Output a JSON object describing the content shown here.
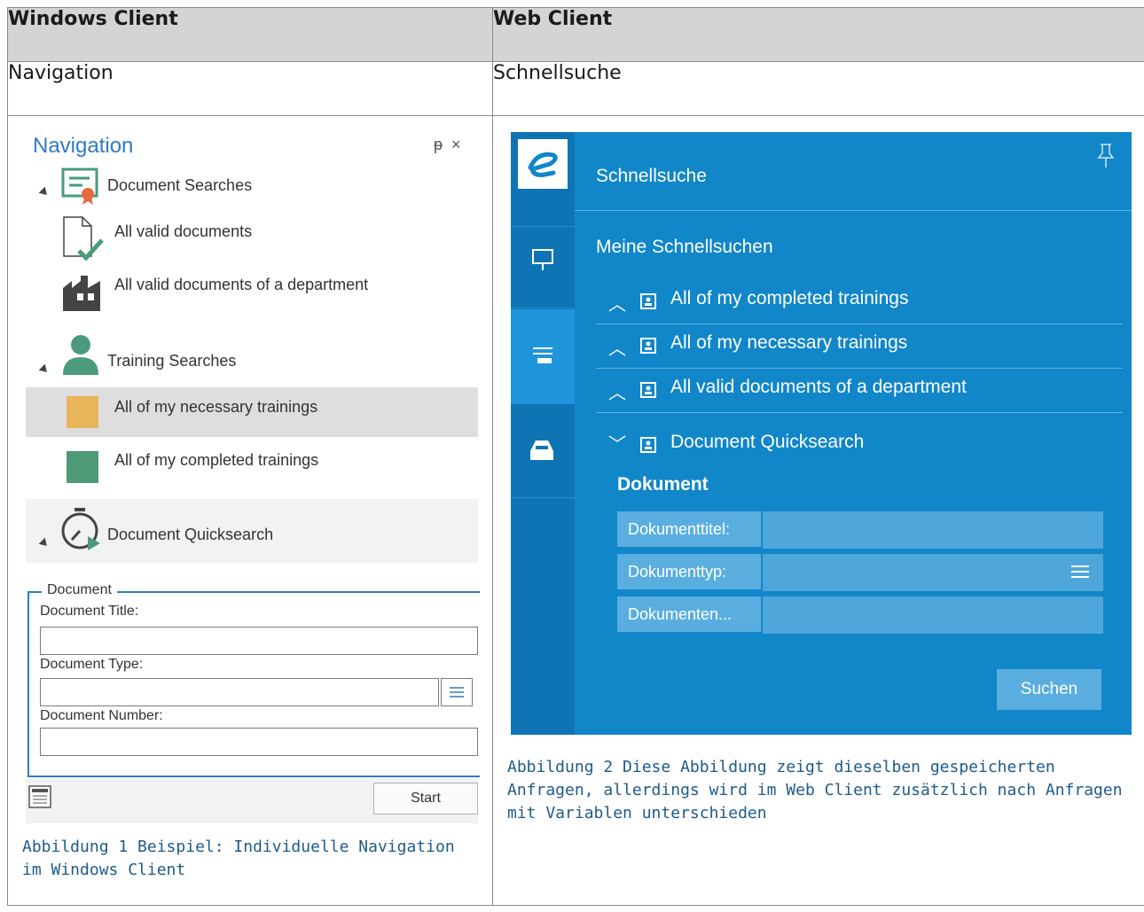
{
  "table": {
    "header_left": "Windows Client",
    "header_right": "Web Client",
    "sub_left": "Navigation",
    "sub_right": "Schnellsuche"
  },
  "windows_client": {
    "panel_title": "Navigation",
    "pin_glyph": "ᵽ",
    "close_glyph": "×",
    "groups": [
      {
        "label": "Document Searches",
        "icon": "certificate-icon",
        "items": [
          {
            "label": "All valid documents",
            "icon": "document-check-icon"
          },
          {
            "label": "All valid documents of a department",
            "icon": "factory-icon"
          }
        ]
      },
      {
        "label": "Training Searches",
        "icon": "person-icon",
        "items": [
          {
            "label": "All of my necessary trainings",
            "color": "#e8b55a",
            "selected": true
          },
          {
            "label": "All of my completed trainings",
            "color": "#4f9a77"
          }
        ]
      },
      {
        "label": "Document Quicksearch",
        "icon": "stopwatch-play-icon"
      }
    ],
    "form": {
      "legend": "Document",
      "title_label": "Document Title:",
      "type_label": "Document Type:",
      "number_label": "Document Number:",
      "title_value": "",
      "type_value": "",
      "number_value": ""
    },
    "start_label": "Start"
  },
  "web_client": {
    "header": "Schnellsuche",
    "section": "Meine Schnellsuchen",
    "items": [
      {
        "label": "All of my completed trainings",
        "expanded": false
      },
      {
        "label": "All of my necessary trainings",
        "expanded": false
      },
      {
        "label": "All valid documents of a department",
        "expanded": false
      },
      {
        "label": "Document Quicksearch",
        "expanded": true
      }
    ],
    "group_title": "Dokument",
    "fields": [
      {
        "label": "Dokumenttitel:",
        "value": ""
      },
      {
        "label": "Dokumenttyp:",
        "value": ""
      },
      {
        "label": "Dokumenten...",
        "value": ""
      }
    ],
    "search_label": "Suchen",
    "colors": {
      "panel": "#1186c9",
      "sidebar": "#0f74b4",
      "field": "#5aaedf"
    }
  },
  "captions": {
    "left": "Abbildung 1 Beispiel: Individuelle Navigation im Windows Client",
    "right": "Abbildung 2 Diese Abbildung zeigt dieselben gespeicherten Anfragen, allerdings wird im Web Client zusätzlich nach Anfragen mit Variablen unterschieden"
  }
}
